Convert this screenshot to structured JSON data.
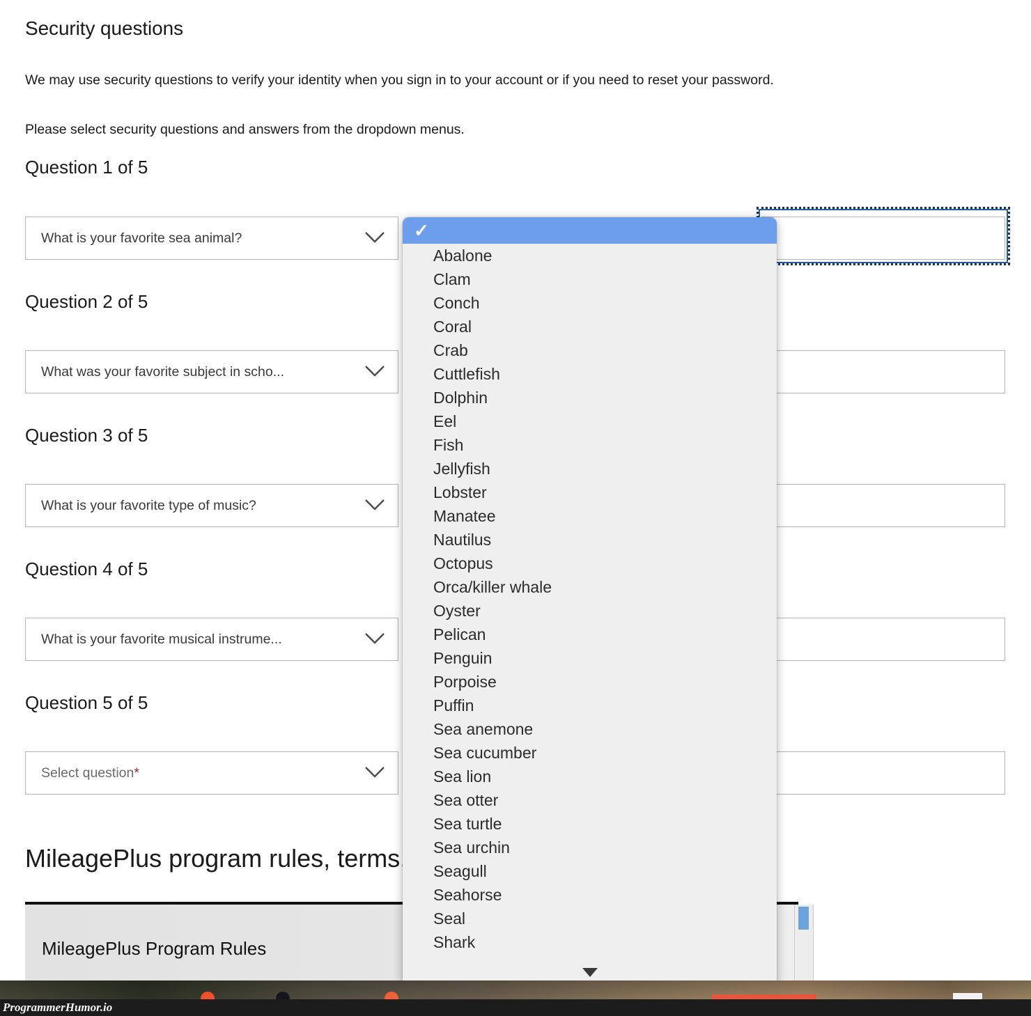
{
  "page": {
    "heading": "Security questions",
    "intro_line_1": "We may use security questions to verify your identity when you sign in to your account or if you need to reset your password.",
    "intro_line_2": "Please select security questions and answers from the dropdown menus."
  },
  "questions": [
    {
      "heading": "Question 1 of 5",
      "selected": "What is your favorite sea animal?",
      "is_placeholder": false
    },
    {
      "heading": "Question 2 of 5",
      "selected": "What was your favorite subject in scho...",
      "is_placeholder": false
    },
    {
      "heading": "Question 3 of 5",
      "selected": "What is your favorite type of music?",
      "is_placeholder": false
    },
    {
      "heading": "Question 4 of 5",
      "selected": "What is your favorite musical instrume...",
      "is_placeholder": false
    },
    {
      "heading": "Question 5 of 5",
      "selected": "Select question",
      "required_marker": "*",
      "is_placeholder": true
    }
  ],
  "dropdown": {
    "selected_index": 0,
    "selected_glyph": "✓",
    "options": [
      "Abalone",
      "Clam",
      "Conch",
      "Coral",
      "Crab",
      "Cuttlefish",
      "Dolphin",
      "Eel",
      "Fish",
      "Jellyfish",
      "Lobster",
      "Manatee",
      "Nautilus",
      "Octopus",
      "Orca/killer whale",
      "Oyster",
      "Pelican",
      "Penguin",
      "Porpoise",
      "Puffin",
      "Sea anemone",
      "Sea cucumber",
      "Sea lion",
      "Sea otter",
      "Sea turtle",
      "Sea urchin",
      "Seagull",
      "Seahorse",
      "Seal",
      "Shark"
    ],
    "scroll_more_icon": "chevron-down-scroll-more",
    "highlight_color": "#6d9eeb",
    "background_color": "#efefef"
  },
  "mileageplus": {
    "section_heading": "MileagePlus program rules, terms, conditions and notices",
    "panel_label": "MileagePlus Program Rules"
  },
  "watermark": {
    "text": "ProgrammerHumor.io"
  }
}
